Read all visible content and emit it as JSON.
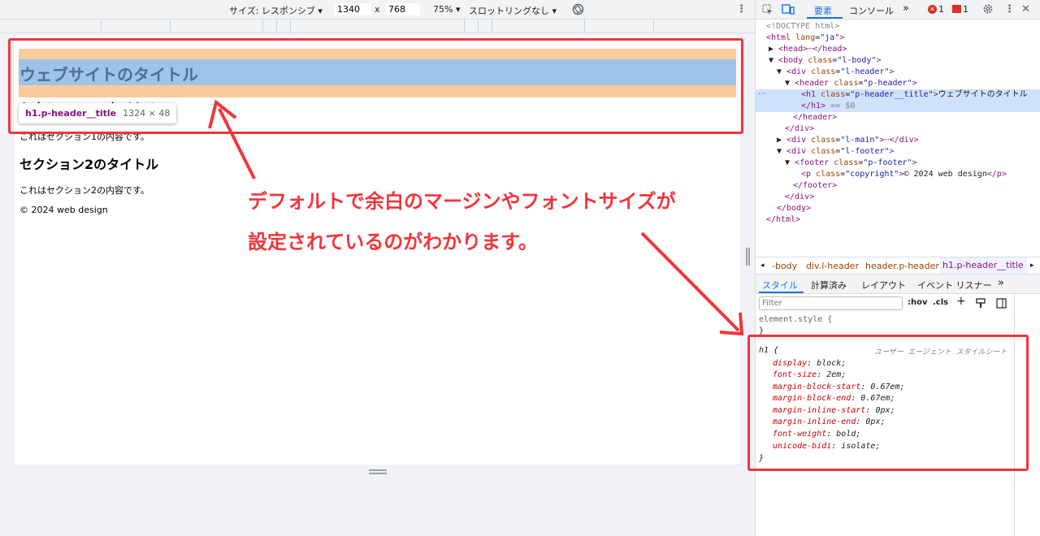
{
  "toolbar": {
    "size_label": "サイズ: レスポンシブ ▾",
    "width": "1340",
    "times": "x",
    "height": "768",
    "zoom": "75% ▾",
    "throttle": "スロットリングなし ▾",
    "more": "⋮"
  },
  "page": {
    "site_title": "ウェブサイトのタイトル",
    "section1_title": "セクション1のタイトル",
    "section1_text": "これはセクション1の内容です。",
    "section2_title": "セクション2のタイトル",
    "section2_text": "これはセクション2の内容です。",
    "copyright": "© 2024 web design"
  },
  "tooltip": {
    "selector": "h1.p-header__title",
    "size": "1324 × 48"
  },
  "annotation": {
    "line1": "デフォルトで余白のマージンやフォントサイズが",
    "line2": "設定されているのがわかります。"
  },
  "devtools": {
    "tabs": [
      "要素",
      "コンソール",
      "»"
    ],
    "errors": "1",
    "warnings": "1",
    "dom": {
      "doctype": "<!DOCTYPE html>",
      "html_open": "<html",
      "lang_attr": "lang",
      "lang_val": "\"ja\"",
      "head": "<head>",
      "head_close": "</head>",
      "body_open": "<body",
      "class_attr": "class",
      "body_class": "\"l-body\"",
      "div_open": "<div",
      "l_header": "\"l-header\"",
      "header_open": "<header",
      "p_header": "\"p-header\"",
      "h1_open": "<h1",
      "h1_class": "\"p-header__title\"",
      "h1_text": "ウェブサイトのタイトル",
      "h1_close": "</h1>",
      "eq_dollar": "== $0",
      "header_close": "</header>",
      "div_close": "</div>",
      "l_main": "\"l-main\"",
      "l_footer": "\"l-footer\"",
      "footer_open": "<footer",
      "p_footer": "\"p-footer\"",
      "p_open": "<p",
      "p_class": "\"copyright\"",
      "p_text": "© 2024 web design",
      "p_close": "</p>",
      "footer_close": "</footer>",
      "body_close": "</body>",
      "html_close": "</html>",
      "gt": ">",
      "ellipsis": "⋯"
    },
    "breadcrumbs": [
      "-body",
      "div.l-header",
      "header.p-header",
      "h1.p-header__title"
    ],
    "sub_tabs": [
      "スタイル",
      "計算済み",
      "レイアウト",
      "イベント リスナー",
      "»"
    ],
    "filter_placeholder": "Filter",
    "hov": ":hov",
    "cls": ".cls",
    "element_style": "element.style {",
    "close_brace": "}",
    "rule_selector": "h1 {",
    "rule_source": "ユーザー エージェント スタイルシート",
    "properties": [
      {
        "name": "display",
        "value": "block;"
      },
      {
        "name": "font-size",
        "value": "2em;"
      },
      {
        "name": "margin-block-start",
        "value": "0.67em;"
      },
      {
        "name": "margin-block-end",
        "value": "0.67em;"
      },
      {
        "name": "margin-inline-start",
        "value": "0px;"
      },
      {
        "name": "margin-inline-end",
        "value": "0px;"
      },
      {
        "name": "font-weight",
        "value": "bold;"
      },
      {
        "name": "unicode-bidi",
        "value": "isolate;"
      }
    ]
  },
  "colors": {
    "accent_red": "#f0363a",
    "devtools_blue": "#1a73e8",
    "margin_orange": "#f8cb9c",
    "content_blue": "#9fc2e8"
  }
}
